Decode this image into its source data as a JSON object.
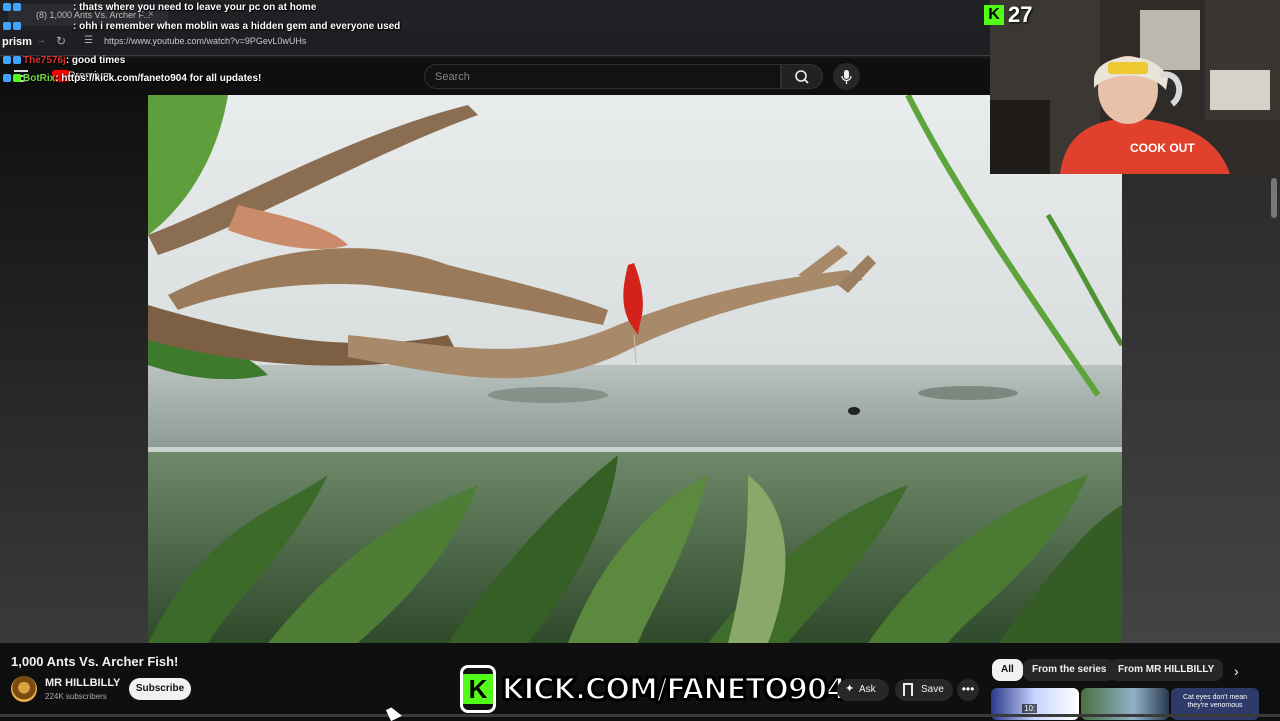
{
  "browser": {
    "tab_title": "(8) 1,000 Ants Vs. Archer F...",
    "tab_close": "×",
    "brand": "prism",
    "forward": "→",
    "reload": "↻",
    "site_info": "☰",
    "url": "https://www.youtube.com/watch?v=9PGevL0wUHs"
  },
  "youtube_header": {
    "premium": "Premium",
    "search_placeholder": "Search"
  },
  "chat": [
    {
      "user": "",
      "text": ": thats where you need to leave your pc on at home",
      "color": "#d33"
    },
    {
      "user": "",
      "text": ": ohh i remember when moblin was a hidden gem and everyone used",
      "color": "#d33"
    },
    {
      "user": "The7576j",
      "text": ": good times",
      "color": "#d33"
    },
    {
      "user": "BotRix",
      "text": ": https://kick.com/faneto904 for all updates!",
      "color": "#6fda4a"
    }
  ],
  "overlay": {
    "kick_count": "27",
    "kick_icon": "K",
    "kick_banner": "KICK.COM/FANETO904"
  },
  "video": {
    "title": "1,000 Ants Vs. Archer Fish!",
    "channel": "MR HILLBILLY",
    "subscribers": "224K subscribers",
    "subscribe_label": "Subscribe",
    "ask_label": "Ask",
    "ask_icon": "✦",
    "save_label": "Save",
    "more_label": "•••"
  },
  "recommend": {
    "chips": [
      "All",
      "From the series",
      "From MR HILLBILLY"
    ],
    "next": "›",
    "thumb1_badge": "10:",
    "thumb3_text": "Cat eyes don't mean they're venomous"
  },
  "colors": {
    "youtube_red": "#ff0000",
    "kick_green": "#53fc18"
  }
}
